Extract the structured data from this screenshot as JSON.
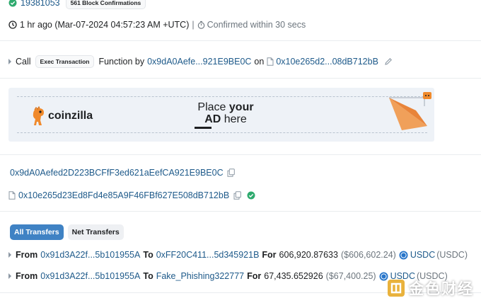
{
  "header": {
    "block_number": "19381053",
    "confirmations_badge": "561 Block Confirmations"
  },
  "timestamp": {
    "relative": "1 hr ago (Mar-07-2024 04:57:23 AM +UTC)",
    "separator": "|",
    "confirmed": "Confirmed within 30 secs"
  },
  "action": {
    "call_label": "Call",
    "method_badge": "Exec Transaction",
    "function_by": "Function by",
    "caller": "0x9dA0Aefe...921E9BE0C",
    "on_label": "on",
    "contract": "0x10e265d2...08dB712bB"
  },
  "ad": {
    "brand": "coinzilla",
    "line1_pre": "Place ",
    "line1_bold": "your",
    "line2_bold": "AD",
    "line2_post": " here",
    "brand_color": "#f08a2c"
  },
  "addresses": {
    "from_full": "0x9dA0Aefed2D223BCFfF3ed621aEefCA921E9BE0C",
    "to_full": "0x10e265d23Ed8Fd4e85A9F46FBf627E508dB712bB"
  },
  "tabs": [
    {
      "label": "All Transfers",
      "active": true
    },
    {
      "label": "Net Transfers",
      "active": false
    }
  ],
  "transfers": [
    {
      "from_label": "From",
      "from": "0x91d3A22f...5b101955A",
      "to_label": "To",
      "to": "0xFF20C411...5d345921B",
      "for_label": "For",
      "amount": "606,920.87633",
      "usd": "($606,602.24)",
      "token": "USDC",
      "token_symbol": "(USDC)"
    },
    {
      "from_label": "From",
      "from": "0x91d3A22f...5b101955A",
      "to_label": "To",
      "to": "Fake_Phishing322777",
      "for_label": "For",
      "amount": "67,435.652926",
      "usd": "($67,400.25)",
      "token": "USDC",
      "token_symbol": "(USDC)"
    }
  ],
  "watermark": {
    "text": "金色财经"
  },
  "colors": {
    "link": "#1e5a8a",
    "success": "#2eaa6e",
    "tab_active": "#3f82c4",
    "usdc": "#2775ca"
  }
}
